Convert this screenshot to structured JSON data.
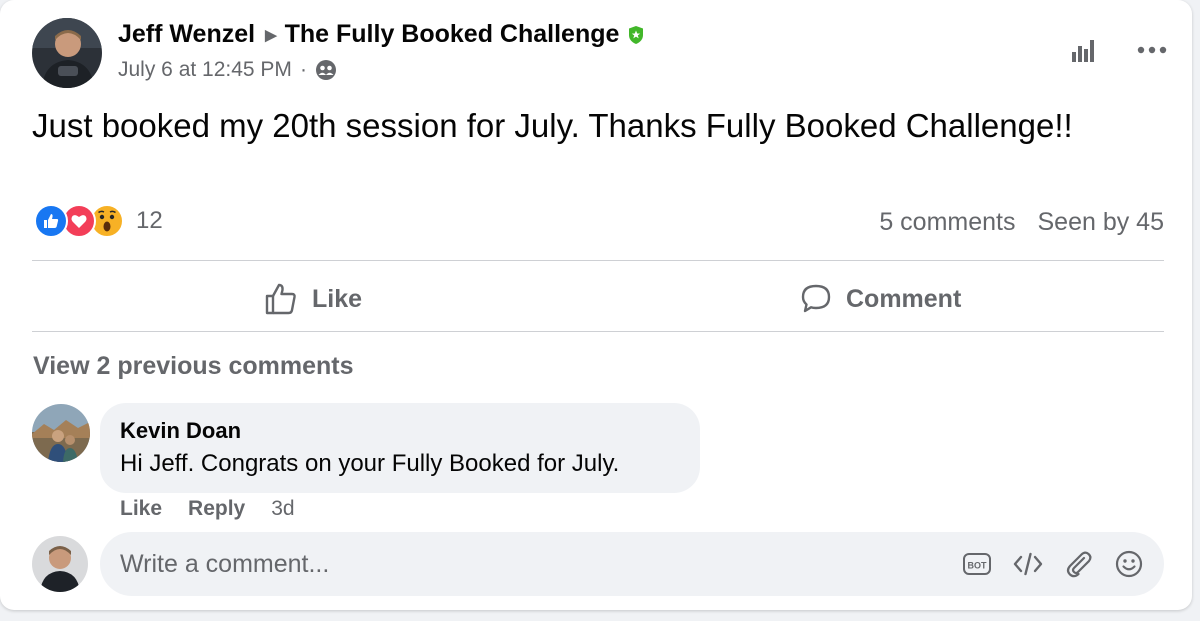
{
  "post": {
    "author": "Jeff Wenzel",
    "group": "The Fully Booked Challenge",
    "timestamp": "July 6 at 12:45 PM",
    "separator": "·",
    "text": "Just booked my 20th session for July. Thanks Fully Booked Challenge!!"
  },
  "reactions": {
    "types": [
      "like-icon",
      "love-icon",
      "wow-icon"
    ],
    "count": "12"
  },
  "stats": {
    "comments": "5 comments",
    "seen_by": "Seen by 45"
  },
  "actions": {
    "like": "Like",
    "comment": "Comment"
  },
  "comments": {
    "view_previous": "View 2 previous comments",
    "items": [
      {
        "author": "Kevin Doan",
        "text": "Hi Jeff. Congrats on your Fully Booked for July.",
        "like": "Like",
        "reply": "Reply",
        "age": "3d"
      }
    ]
  },
  "composer": {
    "placeholder": "Write a comment..."
  },
  "colors": {
    "like_blue": "#1877f2",
    "love_red": "#f33e58",
    "wow_yellow": "#f7b125",
    "badge_green": "#42b72a",
    "muted_text": "#65676b"
  }
}
